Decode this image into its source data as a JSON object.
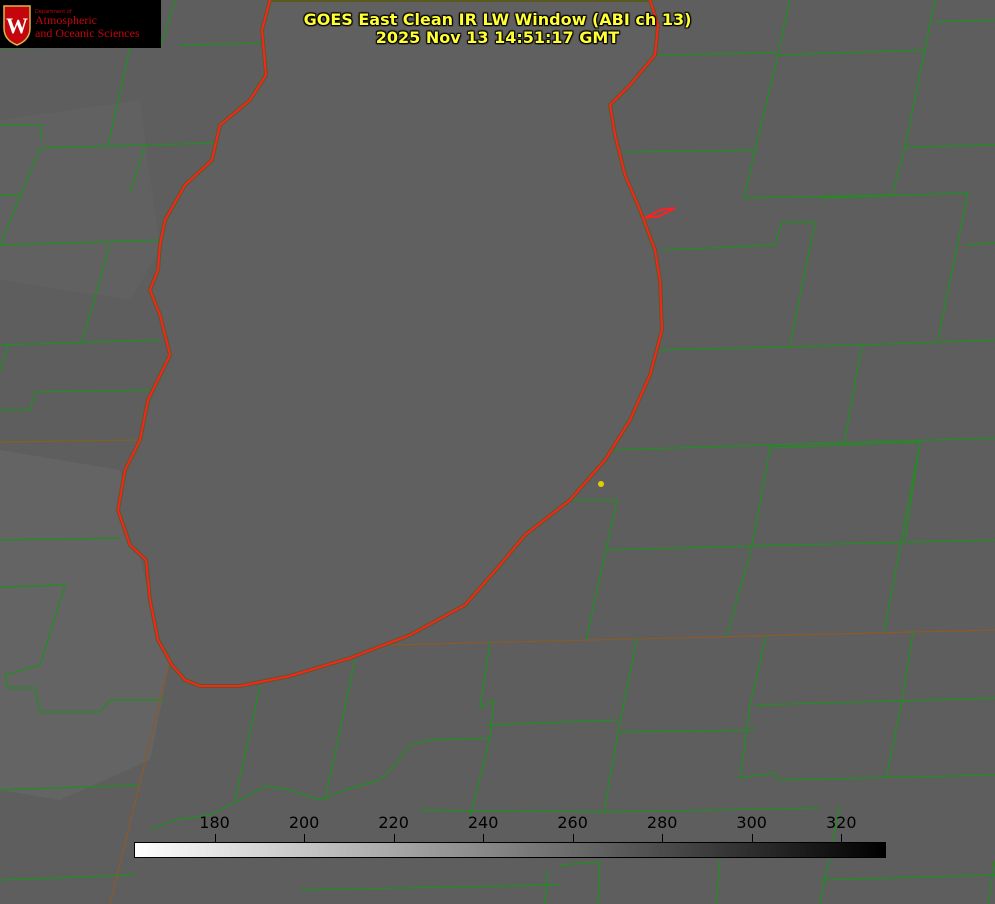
{
  "logo": {
    "department": "Department of",
    "line1": "Atmospheric",
    "line2": "and Oceanic Sciences",
    "crest_letter": "W",
    "brand_color": "#c5050c"
  },
  "title": {
    "line1": "GOES East Clean IR LW Window (ABI ch 13)",
    "line2": "2025 Nov 13 14:51:17 GMT",
    "color": "#ffff33"
  },
  "colorbar": {
    "min": 162,
    "max": 330,
    "ticks": [
      "180",
      "200",
      "220",
      "240",
      "260",
      "280",
      "300",
      "320"
    ],
    "low_color": "#ffffff",
    "high_color": "#000000"
  },
  "map": {
    "land_color": "#5e5e5e",
    "lake_color": "#606060",
    "county_border_color": "#1f8f1f",
    "coastline_color": "#ff2020",
    "marker_color": "#e0d000"
  }
}
